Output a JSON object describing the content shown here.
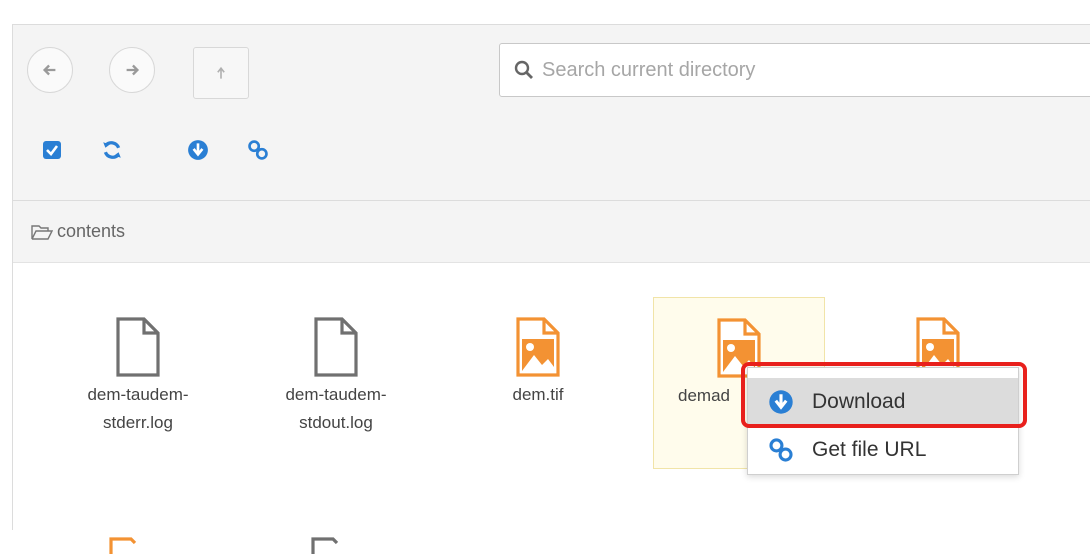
{
  "toolbar": {
    "search_placeholder": "Search current directory"
  },
  "breadcrumb": {
    "label": "contents"
  },
  "files": [
    {
      "name_line1": "dem-taudem-",
      "name_line2": "stderr.log",
      "type": "document"
    },
    {
      "name_line1": "dem-taudem-",
      "name_line2": "stdout.log",
      "type": "document"
    },
    {
      "name_line1": "dem.tif",
      "name_line2": "",
      "type": "image"
    },
    {
      "name_line1": "demad",
      "name_line2": "",
      "type": "image"
    },
    {
      "name_line1": "",
      "name_line2": "",
      "type": "image"
    }
  ],
  "context_menu": {
    "download_label": "Download",
    "get_url_label": "Get file URL"
  },
  "colors": {
    "accent_blue": "#2a7fd4",
    "image_orange": "#f39233",
    "highlight_red": "#e8201c"
  }
}
